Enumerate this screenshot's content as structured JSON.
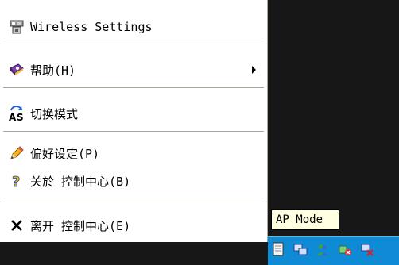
{
  "menu": {
    "items": [
      {
        "label": "Wireless Settings",
        "icon": "wireless-settings-icon"
      },
      {
        "label": "帮助(H)",
        "icon": "help-book-icon",
        "submenu": true
      },
      {
        "label": "切换模式",
        "icon": "switch-mode-icon"
      },
      {
        "label": "偏好设定(P)",
        "icon": "pencil-icon"
      },
      {
        "label": "关於 控制中心(B)",
        "icon": "question-icon"
      },
      {
        "label": "离开 控制中心(E)",
        "icon": "close-x-icon"
      }
    ]
  },
  "tooltip": {
    "text": "AP Mode"
  },
  "taskbar": {
    "tray_icons": [
      "notepad-icon",
      "network-icon",
      "messenger-icon",
      "wireless-alert-icon",
      "network-error-icon"
    ]
  },
  "colors": {
    "taskbar": "#0f8bd6",
    "tooltip_bg": "#ffffe1",
    "menu_bg": "#ffffff",
    "desktop": "#171717"
  }
}
